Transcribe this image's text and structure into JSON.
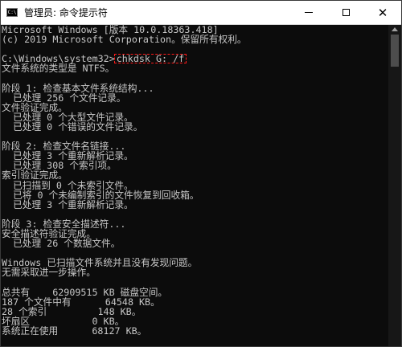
{
  "window": {
    "title": "管理员: 命令提示符",
    "icon_label": "C:\\",
    "controls": {
      "minimize_icon": "minimize-icon",
      "maximize_icon": "maximize-icon",
      "close_glyph": "✕"
    }
  },
  "console": {
    "lines_before": [
      "Microsoft Windows [版本 10.0.18363.418]",
      "(c) 2019 Microsoft Corporation。保留所有权利。",
      ""
    ],
    "prompt": "C:\\Windows\\system32>",
    "command": "chkdsk G: /f",
    "highlight_color": "#ff1a1a",
    "lines_after": [
      "文件系统的类型是 NTFS。",
      "",
      "阶段 1: 检查基本文件系统结构...",
      "  已处理 256 个文件记录。",
      "文件验证完成。",
      "  已处理 0 个大型文件记录。",
      "  已处理 0 个错误的文件记录。",
      "",
      "阶段 2: 检查文件名链接...",
      "  已处理 3 个重新解析记录。",
      "  已处理 308 个索引项。",
      "索引验证完成。",
      "  已扫描到 0 个未索引文件。",
      "  已将 0 个未编制索引的文件恢复到回收箱。",
      "  已处理 3 个重新解析记录。",
      "",
      "阶段 3: 检查安全描述符...",
      "安全描述符验证完成。",
      "  已处理 26 个数据文件。",
      "",
      "Windows 已扫描文件系统并且没有发现问题。",
      "无需采取进一步操作。",
      "",
      "总共有    62909515 KB 磁盘空间。",
      "187 个文件中有      64548 KB。",
      "28 个索引         148 KB。",
      "坏扇区           0 KB。",
      "系统正在使用      68127 KB。"
    ]
  }
}
